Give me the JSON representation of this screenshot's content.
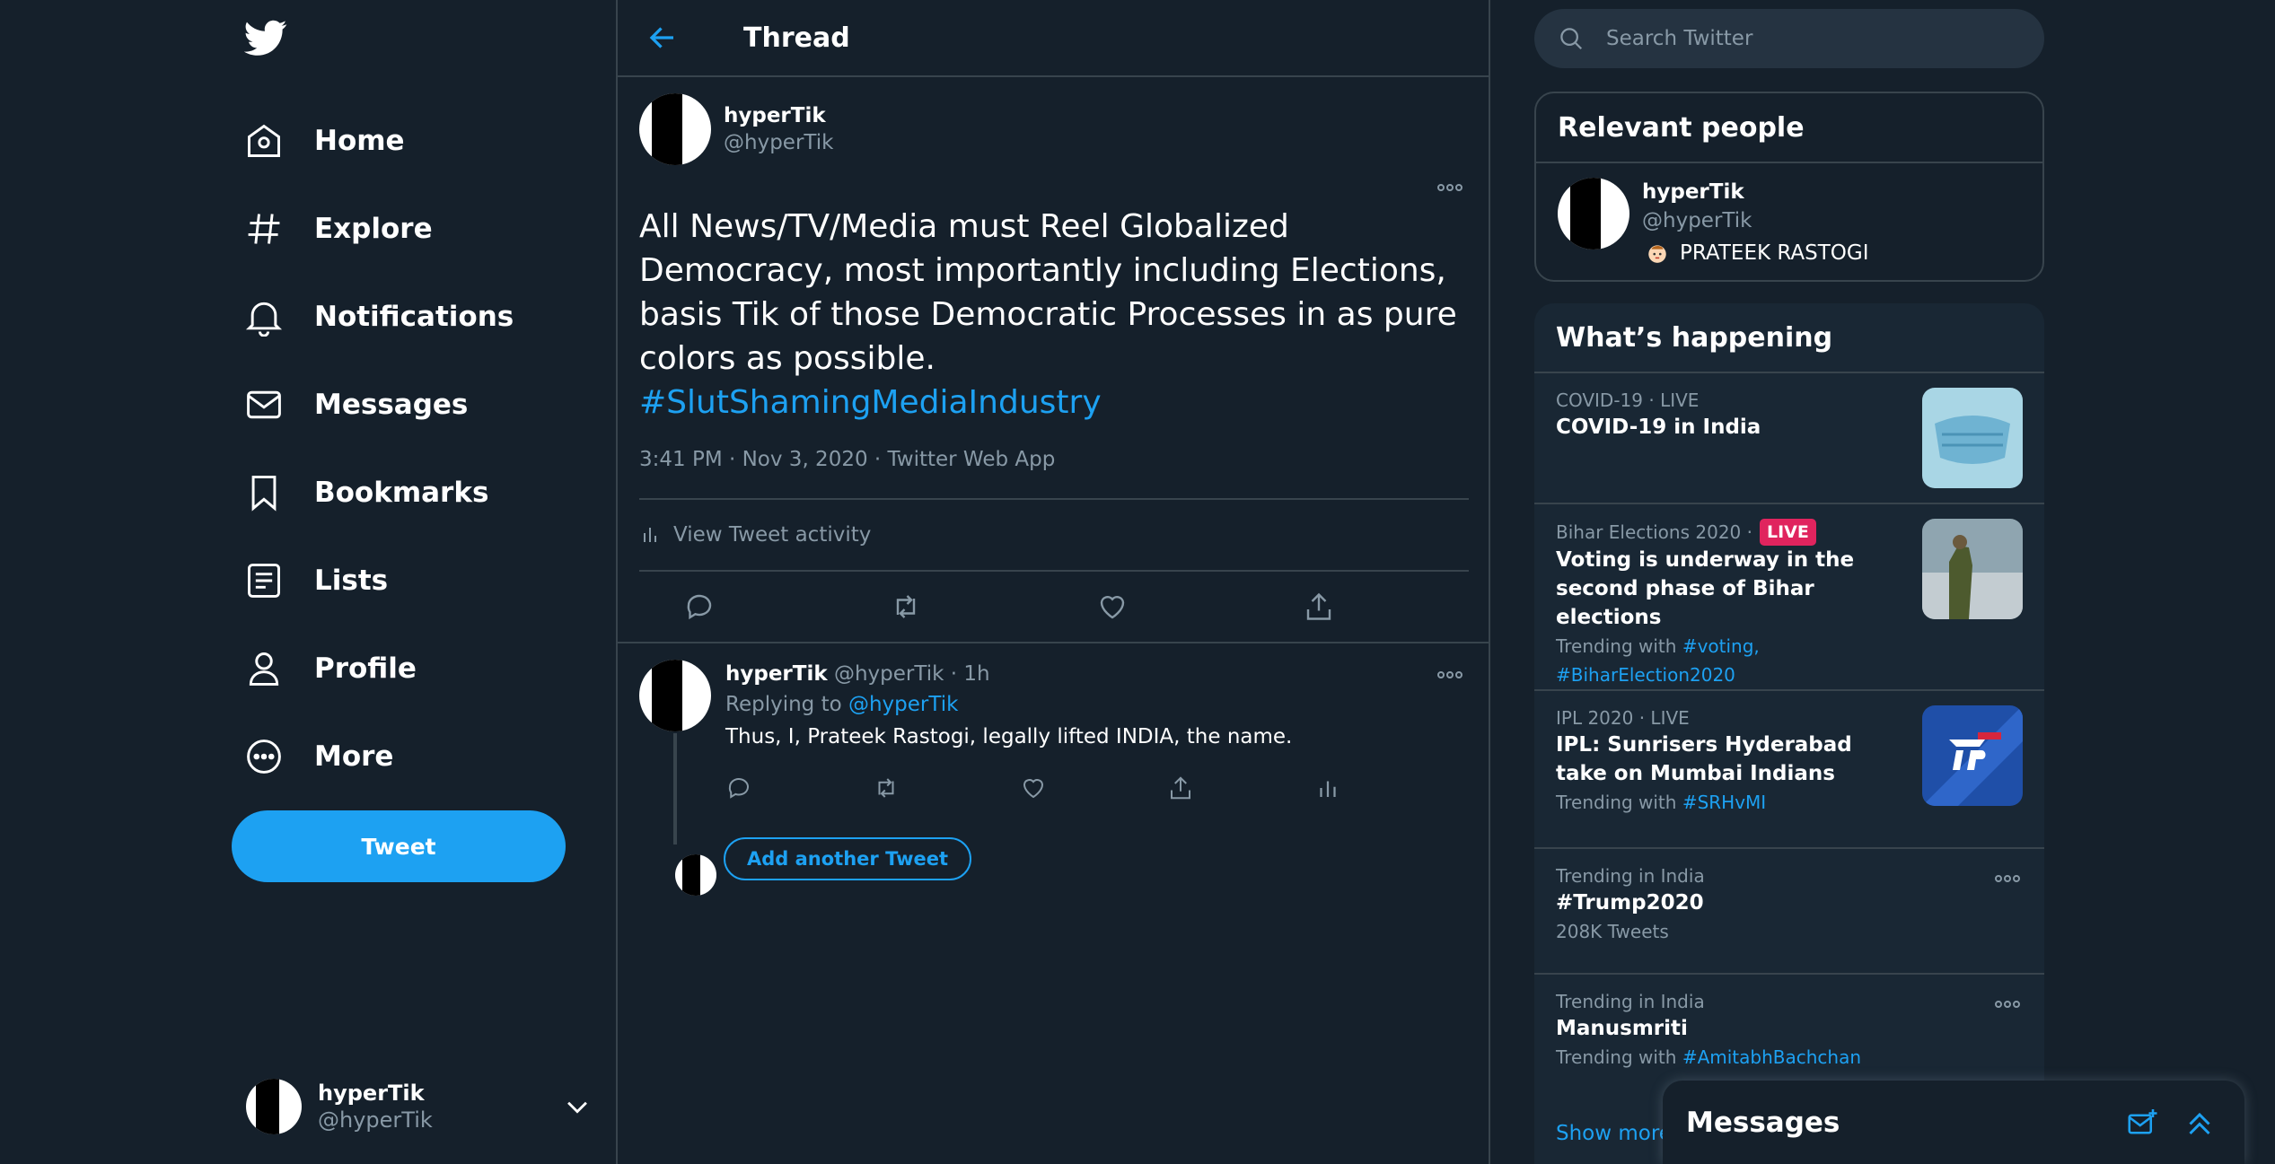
{
  "colors": {
    "background": "#15202b",
    "accent": "#1da1f2",
    "muted": "#8899a6",
    "border": "#38444d",
    "live": "#e0245e"
  },
  "sidebar": {
    "logo_icon": "twitter-bird-icon",
    "nav": [
      {
        "label": "Home",
        "icon": "home-icon"
      },
      {
        "label": "Explore",
        "icon": "hashtag-icon"
      },
      {
        "label": "Notifications",
        "icon": "bell-icon"
      },
      {
        "label": "Messages",
        "icon": "envelope-icon"
      },
      {
        "label": "Bookmarks",
        "icon": "bookmark-icon"
      },
      {
        "label": "Lists",
        "icon": "list-icon"
      },
      {
        "label": "Profile",
        "icon": "person-icon"
      },
      {
        "label": "More",
        "icon": "more-circle-icon"
      }
    ],
    "tweet_button": "Tweet",
    "account": {
      "name": "hyperTik",
      "handle": "@hyperTik"
    }
  },
  "main": {
    "title": "Thread",
    "focal_tweet": {
      "name": "hyperTik",
      "handle": "@hyperTik",
      "text": "All News/TV/Media must Reel Globalized Democracy, most importantly including Elections, basis Tik of those Democratic Processes in as pure colors as possible.",
      "hashtag": "#SlutShamingMediaIndustry",
      "meta": "3:41 PM · Nov 3, 2020 · Twitter Web App",
      "activity": "View Tweet activity"
    },
    "reply": {
      "name": "hyperTik",
      "handle": "@hyperTik",
      "separator": " · ",
      "time": "1h",
      "replying_to_label": "Replying to ",
      "replying_to_handle": "@hyperTik",
      "text": "Thus, I, Prateek Rastogi, legally lifted INDIA, the name."
    },
    "add_tweet": "Add another Tweet"
  },
  "right": {
    "search_placeholder": "Search Twitter",
    "relevant": {
      "title": "Relevant people",
      "name": "hyperTik",
      "handle": "@hyperTik",
      "bio": "PRATEEK RASTOGI"
    },
    "happening": {
      "title": "What’s happening",
      "trends": [
        {
          "meta": "COVID-19 · LIVE",
          "title": "COVID-19 in India"
        },
        {
          "meta": "Bihar Elections 2020 · ",
          "badge": "LIVE",
          "title": "Voting is underway in the second phase of Bihar elections",
          "sub_label": "Trending with ",
          "tags": [
            "#voting,",
            "#BiharElection2020"
          ]
        },
        {
          "meta": "IPL 2020 · LIVE",
          "title": "IPL: Sunrisers Hyderabad take on Mumbai Indians",
          "sub_label": "Trending with ",
          "tags": [
            "#SRHvMI"
          ]
        },
        {
          "meta": "Trending in India",
          "title": "#Trump2020",
          "sub": "208K Tweets"
        },
        {
          "meta": "Trending in India",
          "title": "Manusmriti",
          "sub_label": "Trending with ",
          "tags": [
            "#AmitabhBachchan"
          ]
        }
      ],
      "show_more": "Show more"
    }
  },
  "messages_drawer": {
    "title": "Messages"
  }
}
